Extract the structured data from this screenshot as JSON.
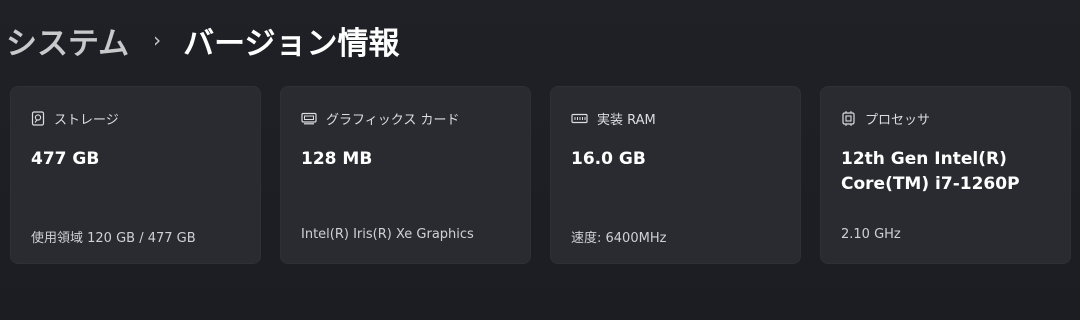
{
  "breadcrumb": {
    "parent": "システム",
    "separator": "›",
    "current": "バージョン情報"
  },
  "cards": [
    {
      "icon": "storage-icon",
      "title": "ストレージ",
      "value": "477 GB",
      "sub": "使用領域 120 GB / 477 GB"
    },
    {
      "icon": "graphics-card-icon",
      "title": "グラフィックス カード",
      "value": "128 MB",
      "sub": "Intel(R) Iris(R) Xe Graphics"
    },
    {
      "icon": "memory-icon",
      "title": "実装 RAM",
      "value": "16.0 GB",
      "sub": "速度: 6400MHz"
    },
    {
      "icon": "processor-icon",
      "title": "プロセッサ",
      "value": "12th Gen Intel(R)\nCore(TM) i7-1260P",
      "sub": "2.10 GHz"
    }
  ],
  "colors": {
    "background": "#1d1f25",
    "card": "#2a2b31",
    "text_primary": "#ffffff",
    "text_secondary": "#d0d0d4"
  }
}
